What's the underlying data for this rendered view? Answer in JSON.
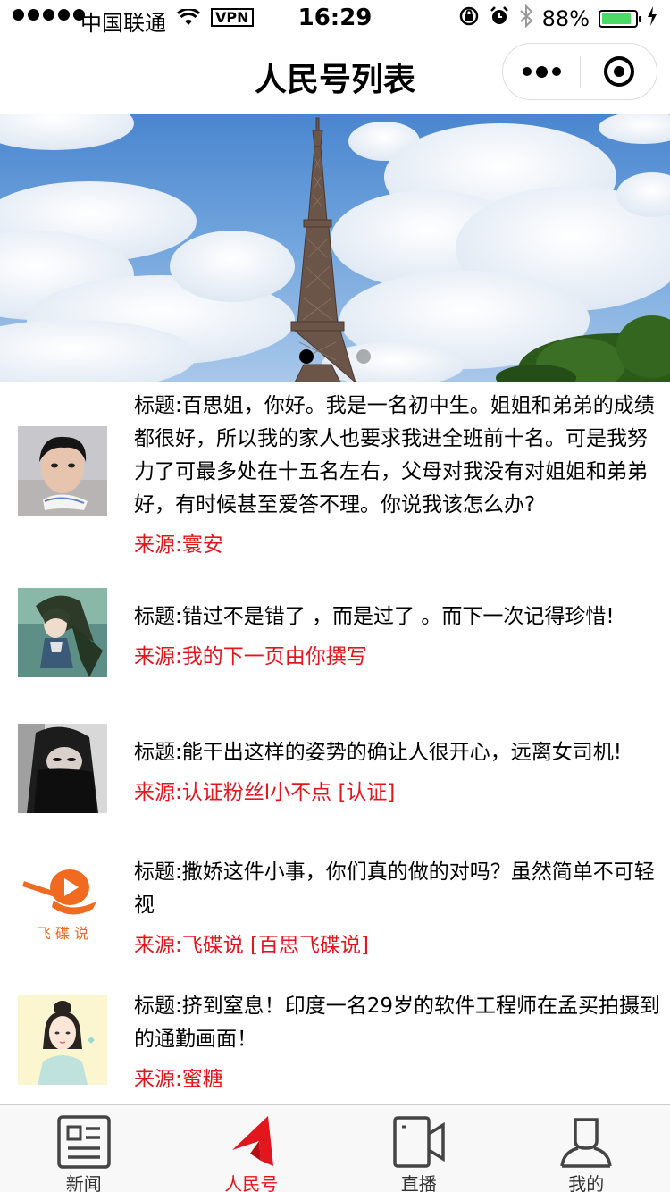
{
  "status_bar": {
    "carrier": "中国联通",
    "vpn": "VPN",
    "time": "16:29",
    "battery": "88%",
    "battery_level": 0.88
  },
  "nav": {
    "title": "人民号列表"
  },
  "banner": {
    "slide_count": 2,
    "active_slide": 1
  },
  "news": [
    {
      "title": "标题:百思姐，你好。我是一名初中生。姐姐和弟弟的成绩都很好，所以我的家人也要求我进全班前十名。可是我努力了可最多处在十五名左右，父母对我没有对姐姐和弟弟好，有时候甚至爱答不理。你说我该怎么办?",
      "source": "来源:寰安"
    },
    {
      "title": "标题:错过不是错了 ，而是过了 。而下一次记得珍惜!",
      "source": "来源:我的下一页由你撰写"
    },
    {
      "title": "标题:能干出这样的姿势的确让人很开心，远离女司机!",
      "source": "来源:认证粉丝l小不点 [认证]"
    },
    {
      "title": "标题:撒娇这件小事，你们真的做的对吗？虽然简单不可轻视",
      "source": "来源:飞碟说 [百思飞碟说]",
      "logo_text": "飞 碟 说"
    },
    {
      "title": "标题:挤到窒息！印度一名29岁的软件工程师在孟买拍摄到的通勤画面！",
      "source": "来源:蜜糖"
    }
  ],
  "tabs": [
    {
      "label": "新闻",
      "icon": "newspaper-icon",
      "active": false
    },
    {
      "label": "人民号",
      "icon": "people-logo-icon",
      "active": true
    },
    {
      "label": "直播",
      "icon": "live-camera-icon",
      "active": false
    },
    {
      "label": "我的",
      "icon": "person-icon",
      "active": false
    }
  ],
  "colors": {
    "accent": "#e4161d",
    "battery": "#4cd964",
    "tab_text": "#333333"
  }
}
